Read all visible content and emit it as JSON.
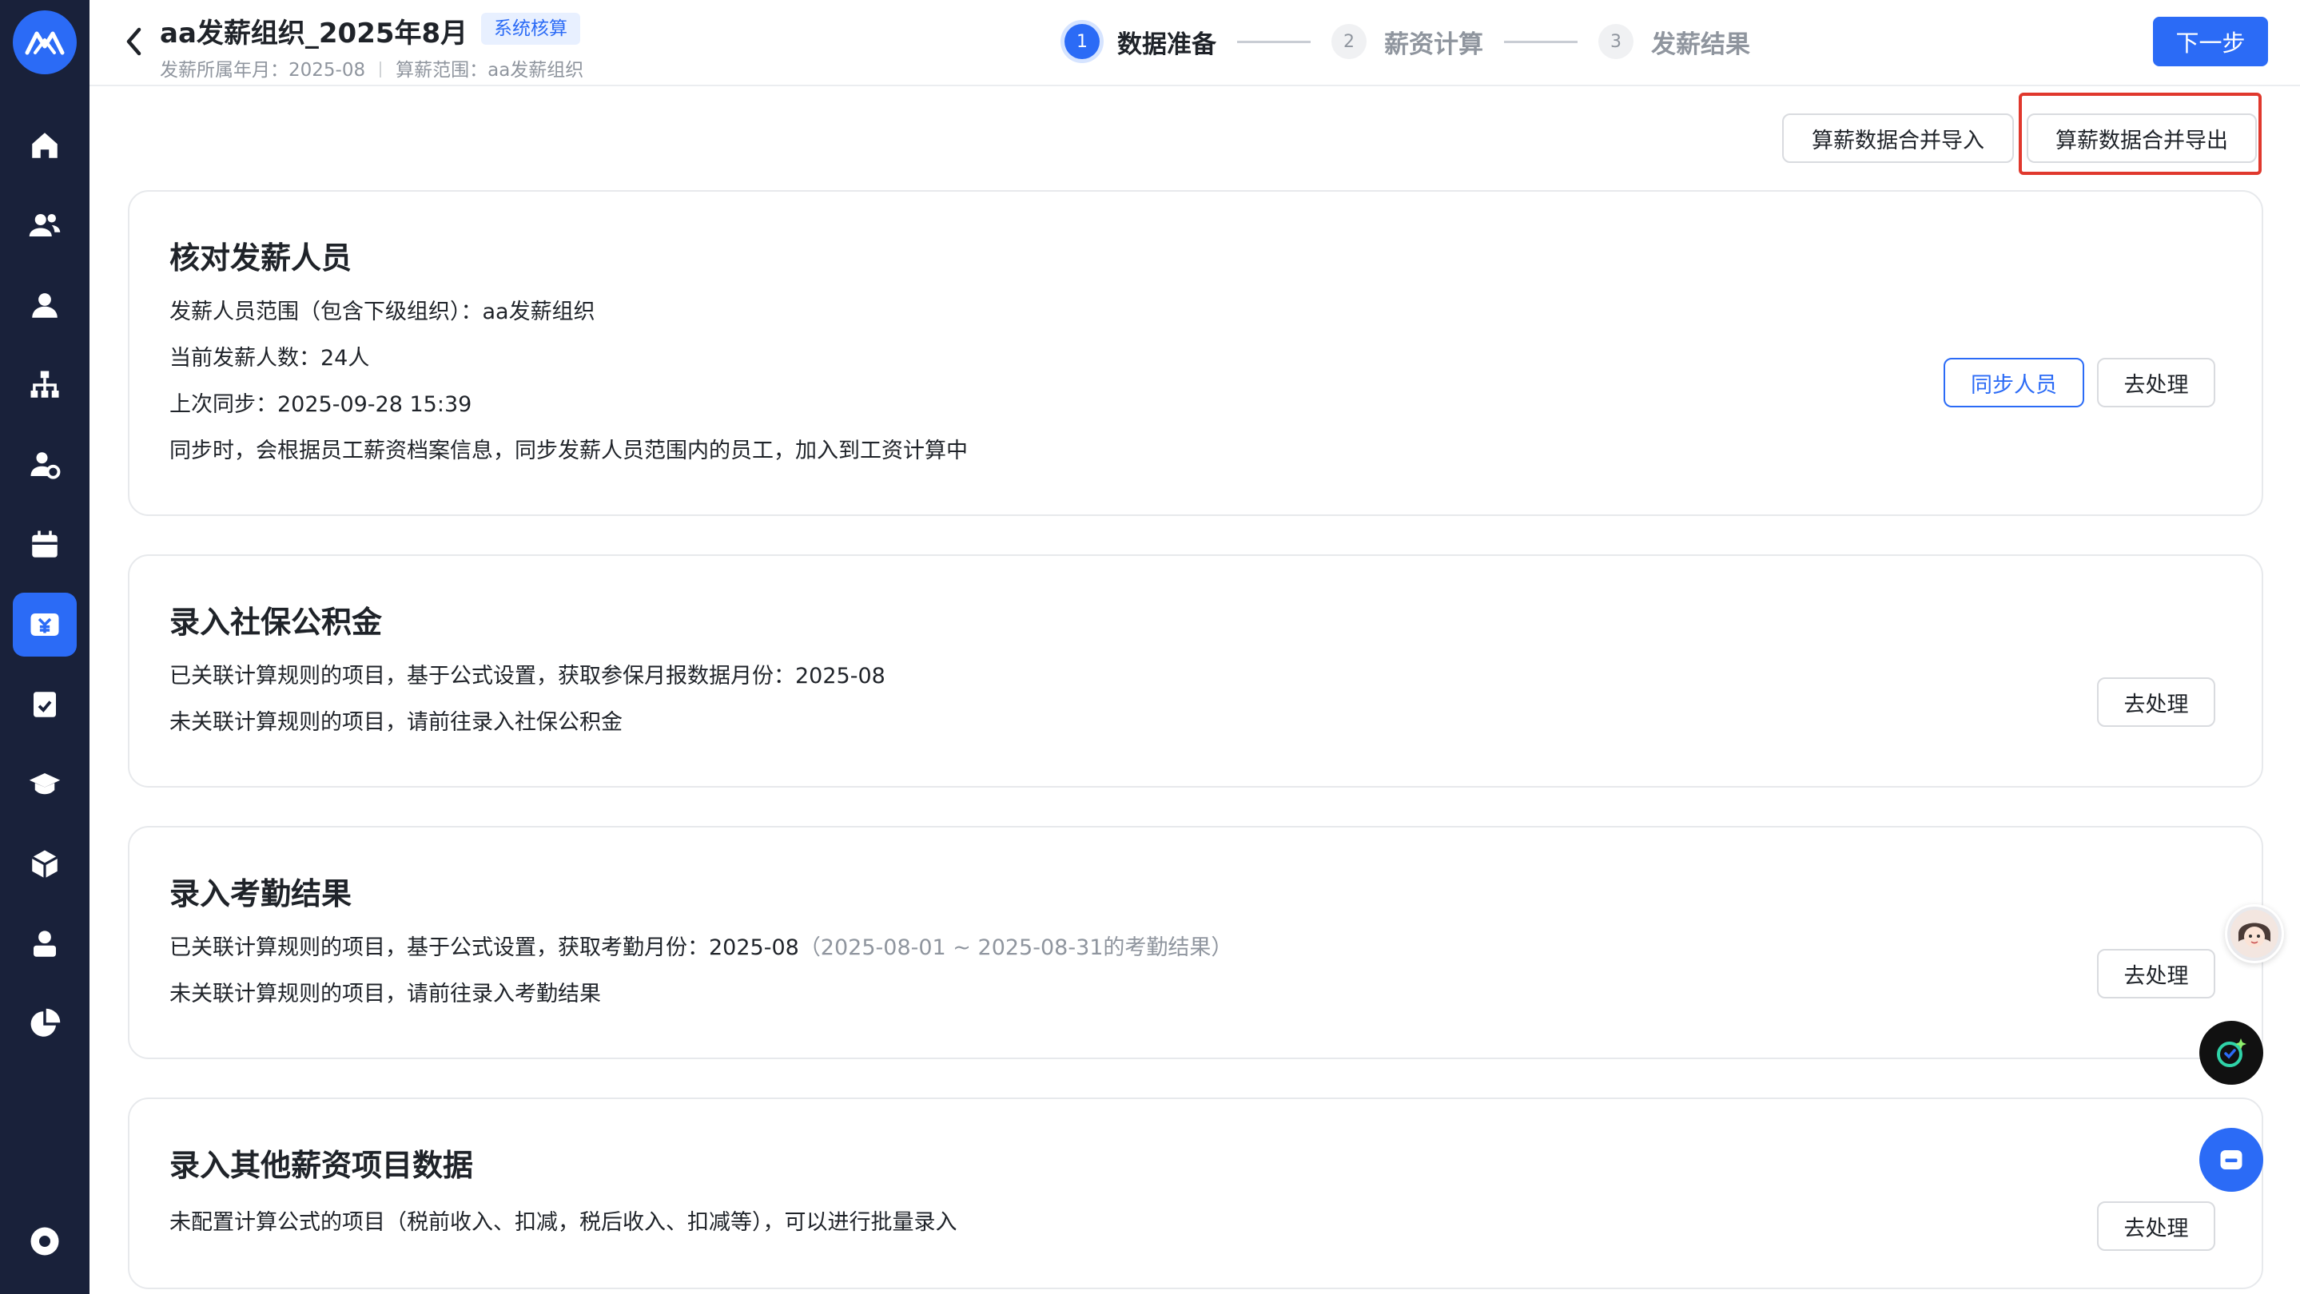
{
  "header": {
    "title": "aa发薪组织_2025年8月",
    "badge": "系统核算",
    "sub_month_label": "发薪所属年月：2025-08",
    "sub_scope_label": "算薪范围：aa发薪组织",
    "next_label": "下一步"
  },
  "steps": [
    {
      "num": "1",
      "label": "数据准备",
      "active": true
    },
    {
      "num": "2",
      "label": "薪资计算",
      "active": false
    },
    {
      "num": "3",
      "label": "发薪结果",
      "active": false
    }
  ],
  "toolbar": {
    "import_label": "算薪数据合并导入",
    "export_label": "算薪数据合并导出"
  },
  "cards": [
    {
      "title": "核对发薪人员",
      "lines": [
        "发薪人员范围（包含下级组织）：aa发薪组织",
        "当前发薪人数：24人",
        "上次同步：2025-09-28 15:39",
        "同步时，会根据员工薪资档案信息，同步发薪人员范围内的员工，加入到工资计算中"
      ],
      "sync_label": "同步人员",
      "action_label": "去处理"
    },
    {
      "title": "录入社保公积金",
      "lines": [
        "已关联计算规则的项目，基于公式设置，获取参保月报数据月份：2025-08",
        "未关联计算规则的项目，请前往录入社保公积金"
      ],
      "action_label": "去处理"
    },
    {
      "title": "录入考勤结果",
      "line1_main": "已关联计算规则的项目，基于公式设置，获取考勤月份：2025-08",
      "line1_muted": "（2025-08-01 ~ 2025-08-31的考勤结果）",
      "line2": "未关联计算规则的项目，请前往录入考勤结果",
      "action_label": "去处理"
    },
    {
      "title": "录入其他薪资项目数据",
      "lines": [
        "未配置计算公式的项目（税前收入、扣减，税后收入、扣减等），可以进行批量录入"
      ],
      "action_label": "去处理"
    }
  ],
  "colors": {
    "primary": "#2b6bf6",
    "sidebar": "#19213a",
    "highlight": "#e0382d"
  }
}
